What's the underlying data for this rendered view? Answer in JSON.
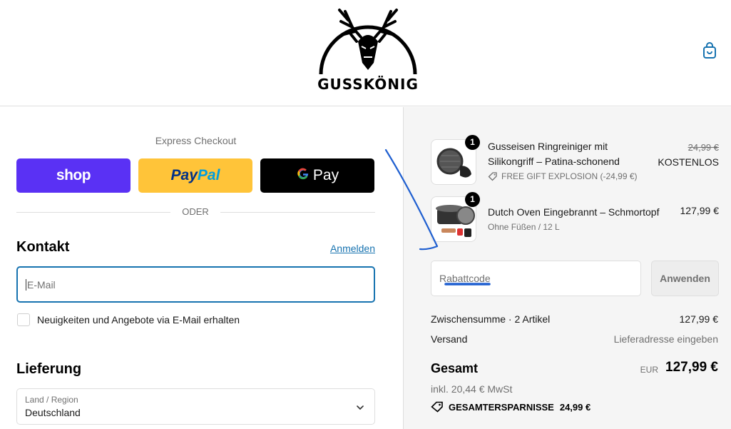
{
  "header": {
    "brand": "GUSSKÖNIG",
    "cart_icon": "shopping-bag-icon"
  },
  "express": {
    "title": "Express Checkout",
    "shop_label": "shop",
    "paypal_label_1": "Pay",
    "paypal_label_2": "Pal",
    "gpay_label": "Pay",
    "divider": "ODER"
  },
  "contact": {
    "title": "Kontakt",
    "login_link": "Anmelden",
    "email_placeholder": "E-Mail",
    "newsletter_label": "Neuigkeiten und Angebote via E-Mail erhalten"
  },
  "delivery": {
    "title": "Lieferung",
    "country_label": "Land / Region",
    "country_value": "Deutschland"
  },
  "cart": {
    "items": [
      {
        "quantity": "1",
        "name_line1": "Gusseisen Ringreiniger mit",
        "name_line2": "Silikongriff – Patina-schonend",
        "discount_label": "FREE GIFT EXPLOSION (-24,99 €)",
        "old_price": "24,99 €",
        "price": "KOSTENLOS"
      },
      {
        "quantity": "1",
        "name_line1": "Dutch Oven Eingebrannt – Schmortopf",
        "variant": "Ohne Füßen / 12 L",
        "price": "127,99 €"
      }
    ],
    "discount_placeholder": "Rabattcode",
    "apply_label": "Anwenden"
  },
  "summary": {
    "subtotal_label": "Zwischensumme · 2 Artikel",
    "subtotal_value": "127,99 €",
    "shipping_label": "Versand",
    "shipping_value": "Lieferadresse eingeben",
    "total_label": "Gesamt",
    "currency": "EUR",
    "total_value": "127,99 €",
    "tax_note": "inkl. 20,44 € MwSt",
    "savings_label": "GESAMTERSPARNISSE",
    "savings_value": "24,99 €"
  },
  "colors": {
    "accent": "#1773b0",
    "shop_pay": "#5a31f4",
    "paypal": "#ffc439",
    "annotation": "#1f5fd0"
  }
}
